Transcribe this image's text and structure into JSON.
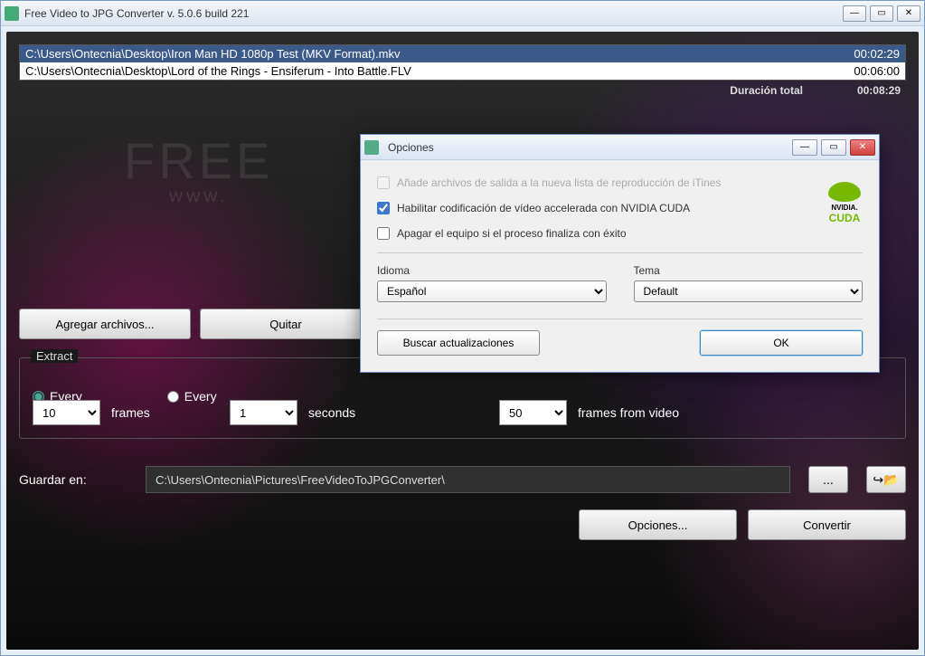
{
  "window": {
    "title": "Free Video to JPG Converter  v. 5.0.6 build 221"
  },
  "files": [
    {
      "path": "C:\\Users\\Ontecnia\\Desktop\\Iron Man HD 1080p Test (MKV Format).mkv",
      "duration": "00:02:29"
    },
    {
      "path": "C:\\Users\\Ontecnia\\Desktop\\Lord of the Rings - Ensiferum - Into Battle.FLV",
      "duration": "00:06:00"
    }
  ],
  "total": {
    "label": "Duración total",
    "value": "00:08:29"
  },
  "bg": {
    "title": "FREE",
    "sub": "WWW."
  },
  "buttons": {
    "add": "Agregar archivos...",
    "remove": "Quitar"
  },
  "extract": {
    "legend": "Extract",
    "radio_every1": "Every",
    "radio_every2": "Every",
    "frames_val": "10",
    "frames_unit": "frames",
    "seconds_val": "1",
    "seconds_unit": "seconds",
    "total_val": "50",
    "total_unit": "frames from video"
  },
  "save": {
    "label": "Guardar en:",
    "path": "C:\\Users\\Ontecnia\\Pictures\\FreeVideoToJPGConverter\\",
    "browse": "...",
    "open": "↪📁"
  },
  "bottom": {
    "options": "Opciones...",
    "convert": "Convertir"
  },
  "dialog": {
    "title": "Opciones",
    "opt1": "Añade archivos de salida a la nueva lista de reproducción de iTines",
    "opt2": "Habilitar codificación de vídeo accelerada con NVIDIA CUDA",
    "opt3": "Apagar el equipo si el proceso finaliza con éxito",
    "cuda_brand": "NVIDIA.",
    "cuda_name": "CUDA",
    "lang_label": "Idioma",
    "lang_value": "Español",
    "theme_label": "Tema",
    "theme_value": "Default",
    "update": "Buscar actualizaciones",
    "ok": "OK"
  }
}
